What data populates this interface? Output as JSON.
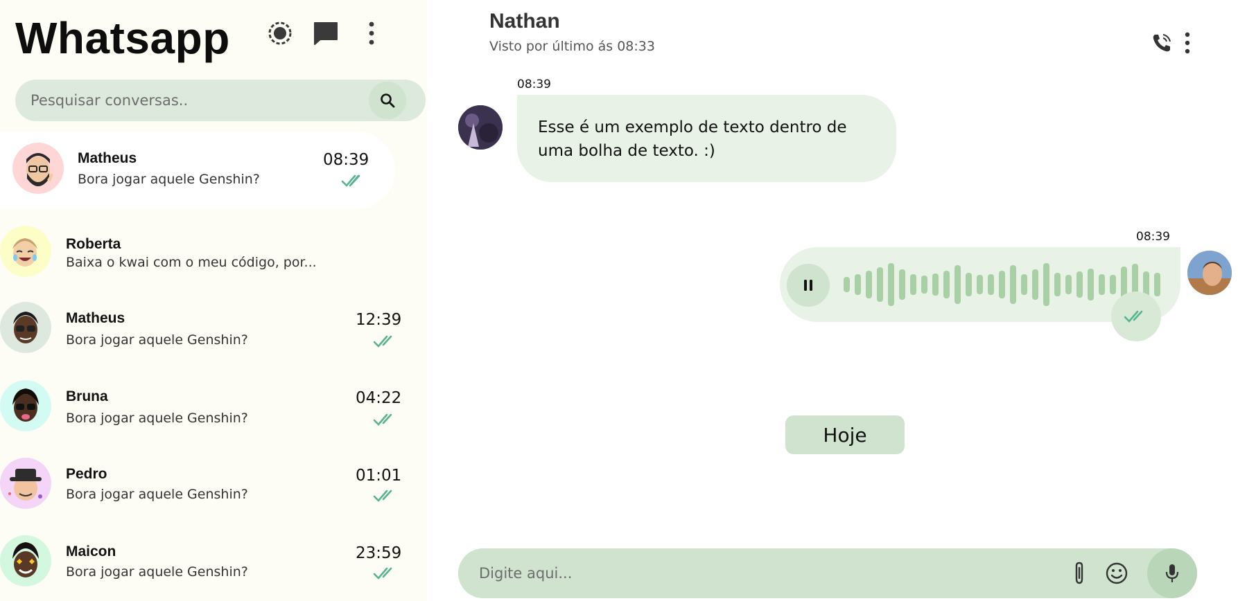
{
  "sidebar": {
    "app_title": "Whatsapp",
    "icons": [
      "status-icon",
      "new-chat-icon",
      "more-vert-icon"
    ],
    "search": {
      "placeholder": "Pesquisar conversas..",
      "value": ""
    },
    "chats": [
      {
        "name": "Matheus",
        "preview": "Bora jogar aquele Genshin?",
        "time": "08:39",
        "read": true,
        "active": true,
        "avatar_bg": "#ffd6d6"
      },
      {
        "name": "Roberta",
        "preview": "Baixa o kwai com o meu código, por...",
        "time": "",
        "read": false,
        "active": false,
        "avatar_bg": "#fdfdc8"
      },
      {
        "name": "Matheus",
        "preview": "Bora jogar aquele Genshin?",
        "time": "12:39",
        "read": true,
        "active": false,
        "avatar_bg": "#dfe8df"
      },
      {
        "name": "Bruna",
        "preview": "Bora jogar aquele Genshin?",
        "time": "04:22",
        "read": true,
        "active": false,
        "avatar_bg": "#d4fbf3"
      },
      {
        "name": "Pedro",
        "preview": "Bora jogar aquele Genshin?",
        "time": "01:01",
        "read": true,
        "active": false,
        "avatar_bg": "#f4d4f7"
      },
      {
        "name": "Maicon",
        "preview": "Bora jogar aquele Genshin?",
        "time": "23:59",
        "read": true,
        "active": false,
        "avatar_bg": "#d4f7e0"
      }
    ]
  },
  "chat": {
    "contact_name": "Nathan",
    "last_seen": "Visto por último ás 08:33",
    "icons": [
      "phone-call-icon",
      "more-vert-icon"
    ],
    "messages": [
      {
        "direction": "incoming",
        "type": "text",
        "time": "08:39",
        "text": "Esse é um exemplo de texto dentro de uma bolha de texto. :)"
      },
      {
        "direction": "outgoing",
        "type": "audio",
        "time": "08:39",
        "playing": true,
        "read": true
      }
    ],
    "day_divider": "Hoje",
    "composer": {
      "placeholder": "Digite aqui...",
      "value": "",
      "icons": [
        "attach-icon",
        "emoji-icon",
        "mic-icon"
      ]
    }
  },
  "colors": {
    "accent_light": "#e8f2e6",
    "accent": "#cfe3cf",
    "check": "#56b38f",
    "wave": "#a9cfa4",
    "sidebar_bg": "#fdfdf6"
  }
}
